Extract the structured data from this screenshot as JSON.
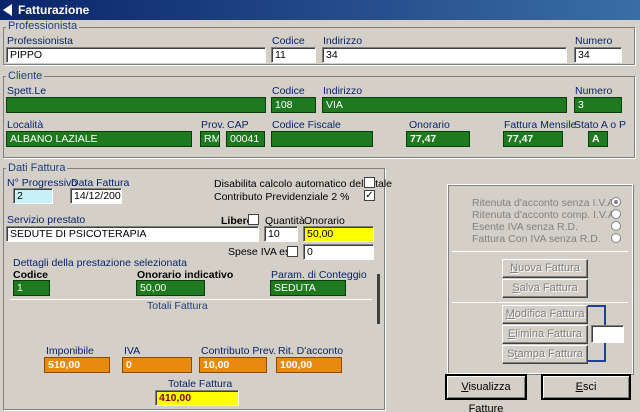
{
  "window": {
    "title": "Fatturazione"
  },
  "professionista": {
    "legend": "Professionista",
    "labels": {
      "nome": "Professionista",
      "codice": "Codice",
      "indirizzo": "Indirizzo",
      "numero": "Numero"
    },
    "values": {
      "nome": "PIPPO",
      "codice": "11",
      "indirizzo": "34",
      "numero": "34"
    }
  },
  "cliente": {
    "legend": "Cliente",
    "labels": {
      "spett": "Spett.Le",
      "codice": "Codice",
      "indirizzo": "Indirizzo",
      "numero": "Numero",
      "localita": "Località",
      "prov": "Prov.",
      "cap": "CAP",
      "cf": "Codice Fiscale",
      "onorario": "Onorario",
      "fattura_mensile": "Fattura Mensile",
      "stato": "Stato A o P"
    },
    "values": {
      "spett": "",
      "codice": "108",
      "indirizzo": "VIA",
      "numero": "3",
      "localita": "ALBANO LAZIALE",
      "prov": "RM",
      "cap": "00041",
      "cf": "",
      "onorario": "77,47",
      "fattura_mensile": "77,47",
      "stato": "A"
    }
  },
  "dati_fattura": {
    "legend": "Dati Fattura",
    "labels": {
      "progressivo": "N° Progressivo",
      "data": "Data Fattura",
      "disabilita": "Disabilita calcolo automatico del totale",
      "contributo": "Contributo Previdenziale 2 %",
      "servizio": "Servizio prestato",
      "libero": "Libero",
      "quantita": "Quantità",
      "onorario": "Onorario",
      "spese": "Spese IVA es."
    },
    "values": {
      "progressivo": "2",
      "data": "14/12/2005",
      "servizio": "SEDUTE DI PSICOTERAPIA",
      "quantita": "10",
      "onorario": "50,00",
      "spese": "0"
    },
    "checks": {
      "disabilita": "",
      "contributo": "✓",
      "libero": "",
      "spese": ""
    }
  },
  "dettagli": {
    "title": "Dettagli della prestazione selezionata",
    "labels": {
      "codice": "Codice",
      "onorario_ind": "Onorario indicativo",
      "param": "Param. di Conteggio"
    },
    "values": {
      "codice": "1",
      "onorario_ind": "50,00",
      "param": "SEDUTA"
    }
  },
  "totali": {
    "title": "Totali Fattura",
    "labels": {
      "imponibile": "Imponibile",
      "iva": "IVA",
      "contributo": "Contributo Prev.",
      "ritenuta": "Rit. D'acconto",
      "totale": "Totale Fattura"
    },
    "values": {
      "imponibile": "510,00",
      "iva": "0",
      "contributo": "10,00",
      "ritenuta": "100,00",
      "totale": "410,00"
    }
  },
  "opzioni": [
    {
      "label": "Ritenuta d'acconto senza I.V.A.",
      "selected": true
    },
    {
      "label": "Ritenuta d'acconto comp. I.V.A.",
      "selected": false
    },
    {
      "label": "Esente IVA senza R.D.",
      "selected": false
    },
    {
      "label": "Fattura Con IVA senza R.D.",
      "selected": false
    }
  ],
  "buttons": {
    "nuova": {
      "pre": "",
      "acc": "N",
      "post": "uova Fattura"
    },
    "salva": {
      "pre": "",
      "acc": "S",
      "post": "alva Fattura"
    },
    "modifica": {
      "pre": "",
      "acc": "M",
      "post": "odifica Fattura"
    },
    "elimina": {
      "pre": "",
      "acc": "E",
      "post": "limina Fattura"
    },
    "stampa": {
      "pre": "S",
      "acc": "t",
      "post": "ampa Fattura"
    },
    "visualizza": {
      "pre": "",
      "acc": "V",
      "post": "isualizza Fatture"
    },
    "esci": {
      "pre": "",
      "acc": "E",
      "post": "sci"
    }
  },
  "colors": {
    "title_start": "#0a246a",
    "title_end": "#3a6ea5",
    "green": "#1f7a1f",
    "orange": "#e88a10",
    "yellow": "#ffff00",
    "cyan": "#c8f0f8"
  }
}
